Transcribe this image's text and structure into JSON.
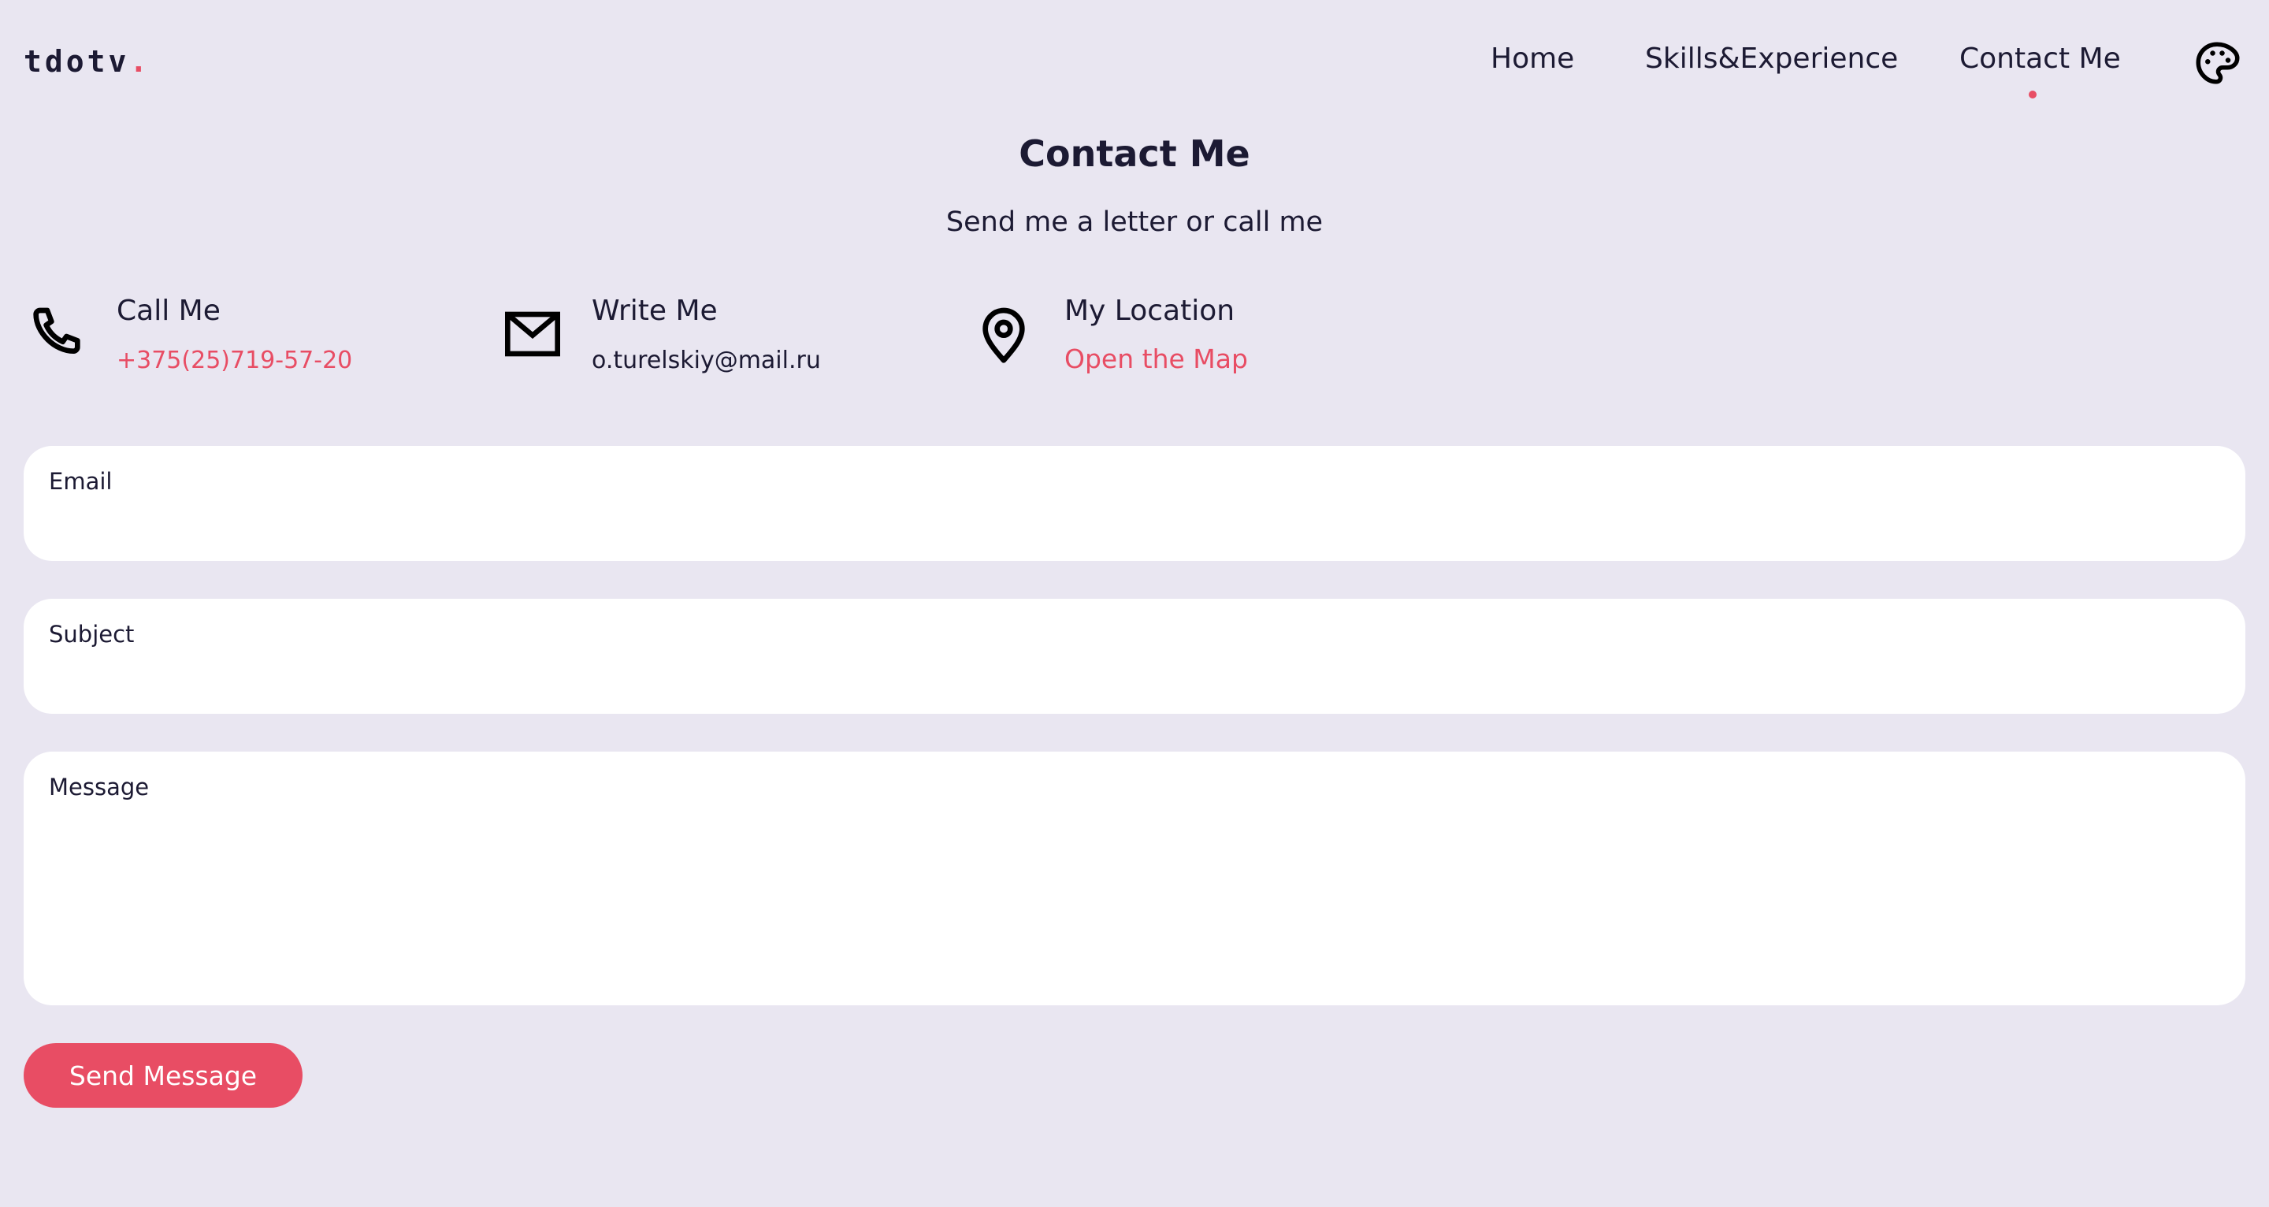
{
  "header": {
    "logo_text": "tdotv",
    "logo_dot": ".",
    "nav": {
      "home": "Home",
      "skills": "Skills&Experience",
      "contact": "Contact Me"
    },
    "active_nav": "Contact Me",
    "theme_icon": "palette-icon"
  },
  "main": {
    "title": "Contact Me",
    "subtitle": "Send me a letter or call me"
  },
  "contact_info": {
    "call": {
      "icon": "phone-icon",
      "label": "Call Me",
      "value": "+375(25)719-57-20"
    },
    "write": {
      "icon": "mail-icon",
      "label": "Write Me",
      "value": "o.turelskiy@mail.ru"
    },
    "location": {
      "icon": "map-pin-icon",
      "label": "My Location",
      "value": "Open the Map"
    }
  },
  "form": {
    "email_label": "Email",
    "email_value": "",
    "subject_label": "Subject",
    "subject_value": "",
    "message_label": "Message",
    "message_value": "",
    "submit_label": "Send Message"
  },
  "colors": {
    "background": "#e9e6f1",
    "text": "#1c1a33",
    "accent": "#e84d64",
    "field_background": "#ffffff"
  }
}
